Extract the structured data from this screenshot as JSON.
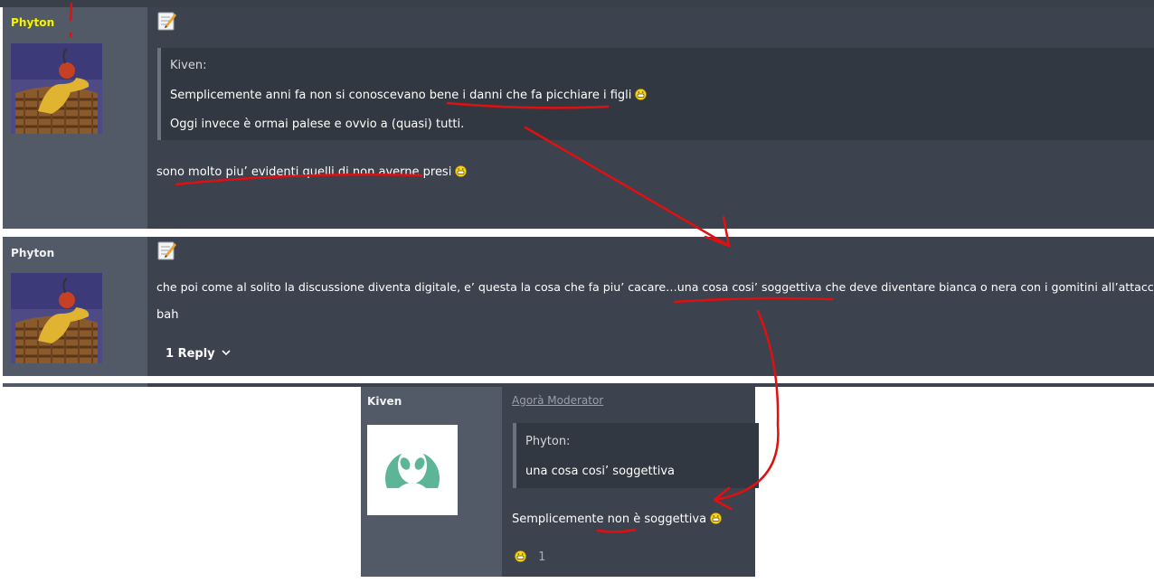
{
  "posts": [
    {
      "author": "Phyton",
      "quote": {
        "author": "Kiven:",
        "line1": "Semplicemente anni fa non si conoscevano bene i danni che fa picchiare i figli",
        "line2": "Oggi invece è ormai palese e ovvio a (quasi) tutti."
      },
      "text": "sono molto piu’ evidenti quelli di non averne presi"
    },
    {
      "author": "Phyton",
      "text_line1": "che poi come al solito la discussione diventa digitale, e’ questa la cosa che fa piu’ cacare…una cosa cosi’ soggettiva che deve diventare bianca o nera con i gomitini all’attacco",
      "text_line2": "bah",
      "reply_label": "1 Reply"
    }
  ],
  "reply": {
    "author": "Kiven",
    "role": "Agorà Moderator",
    "quote": {
      "author": "Phyton:",
      "text": "una cosa cosi’ soggettiva"
    },
    "text": "Semplicemente non è soggettiva",
    "reaction_count": "1"
  },
  "colors": {
    "post_bg": "#3c424e",
    "sidebar_bg": "#535a67",
    "quote_bg": "#323841",
    "username_highlight": "#f5f500",
    "annotation_red": "#e01010",
    "alien_avatar": "#5bb596"
  },
  "icons": [
    "edit-note-icon",
    "grinning-emoji-icon",
    "chevron-down-icon",
    "alien-avatar-icon"
  ]
}
